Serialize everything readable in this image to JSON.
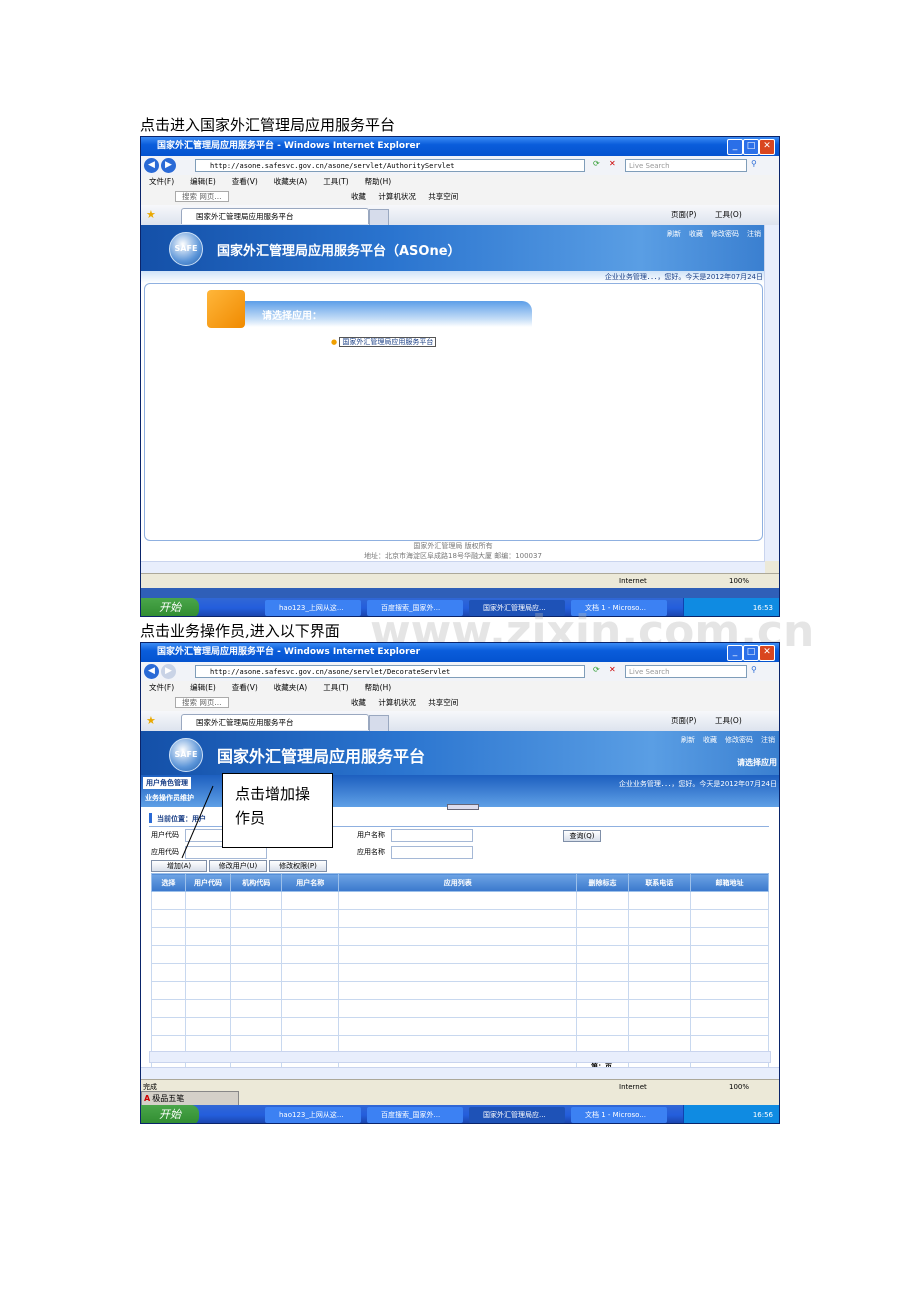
{
  "captions": {
    "first": "点击进入国家外汇管理局应用服务平台",
    "second": "点击业务操作员,进入以下界面"
  },
  "watermark": "www.zixin.com.cn",
  "browser": {
    "title": "国家外汇管理局应用服务平台 - Windows Internet Explorer",
    "search_placeholder": "Live Search",
    "menu": [
      "文件(F)",
      "编辑(E)",
      "查看(V)",
      "收藏夹(A)",
      "工具(T)",
      "帮助(H)"
    ],
    "toolbar": {
      "search_box": "搜索 网页...",
      "favorites": "收藏",
      "pc_status": "计算机状况",
      "share_space": "共享空间"
    },
    "tab_title": "国家外汇管理局应用服务平台",
    "page_menu": "页面(P)",
    "tools_menu": "工具(O)",
    "zone": "Internet",
    "zoom": "100%"
  },
  "shot1": {
    "url": "http://asone.safesvc.gov.cn/asone/servlet/AuthorityServlet",
    "banner_title": "国家外汇管理局应用服务平台（ASOne）",
    "top_links": [
      "刷新",
      "收藏",
      "修改密码",
      "注销"
    ],
    "greeting": "企业业务管理．．．，您好。今天是2012年07月24日",
    "select_heading": "请选择应用：",
    "app_link": "国家外汇管理局应用服务平台",
    "footer": [
      "国家外汇管理局 版权所有",
      "地址：北京市海淀区阜成路18号华融大厦 邮编：100037"
    ],
    "clock": "16:53"
  },
  "shot2": {
    "url": "http://asone.safesvc.gov.cn/asone/servlet/DecorateServlet",
    "banner_title": "国家外汇管理局应用服务平台",
    "top_links": [
      "刷新",
      "收藏",
      "修改密码",
      "注销"
    ],
    "select_app": "请选择应用",
    "greeting": "企业业务管理．．．，您好。今天是2012年07月24日",
    "side_items": [
      "用户角色管理",
      "业务操作员维护"
    ],
    "breadcrumb": "当前位置：用户",
    "fields": {
      "user_code": "用户代码",
      "user_name": "用户名称",
      "app_code": "应用代码",
      "app_name": "应用名称"
    },
    "query_btn": "查询(Q)",
    "buttons": [
      "增加(A)",
      "修改用户(U)",
      "修改权限(P)"
    ],
    "columns": [
      "选择",
      "用户代码",
      "机构代码",
      "用户名称",
      "应用列表",
      "删除标志",
      "联系电话",
      "邮箱地址"
    ],
    "pager": "第：页",
    "status": "完成",
    "ime": "极品五笔",
    "clock": "16:56"
  },
  "callout": "点击增加操作员",
  "taskbar": {
    "start": "开始",
    "items": [
      "hao123_上网从这...",
      "百度搜索_国家外...",
      "国家外汇管理局应...",
      "文档 1 - Microso..."
    ]
  }
}
